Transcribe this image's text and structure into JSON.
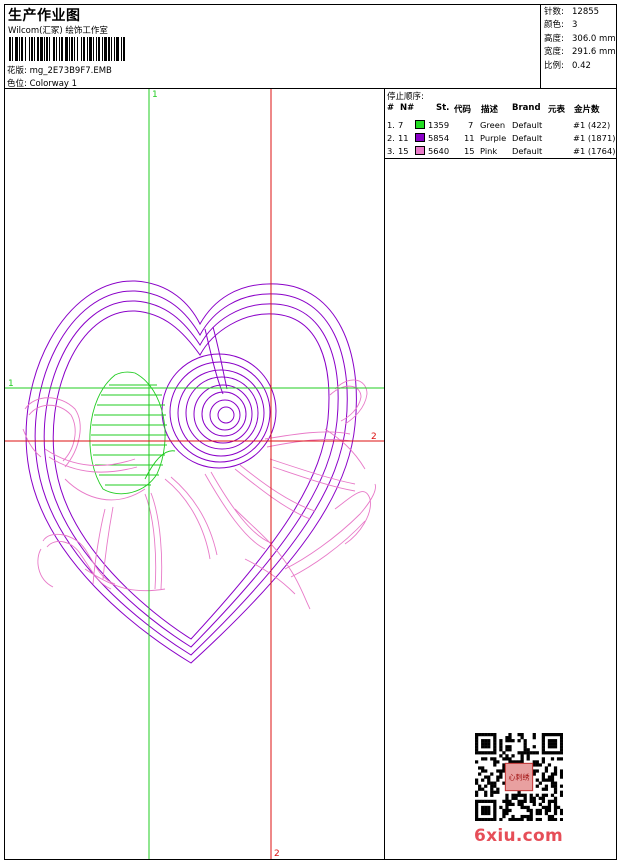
{
  "header": {
    "title": "生产作业图",
    "company": "Wilcom(汇冢) 绘饰工作室",
    "design_label": "花版:",
    "design_value": "mg_2E73B9F7.EMB",
    "colorway_label": "色位:",
    "colorway_value": "Colorway 1"
  },
  "stats": [
    {
      "label": "针数:",
      "value": "12855"
    },
    {
      "label": "颜色:",
      "value": "3"
    },
    {
      "label": "高度:",
      "value": "306.0 mm"
    },
    {
      "label": "宽度:",
      "value": "291.6 mm"
    },
    {
      "label": "比例:",
      "value": "0.42"
    }
  ],
  "stop_sequence": {
    "title": "停止顺序:",
    "columns": [
      "#",
      "N#",
      "St.",
      "代码",
      "描述",
      "Brand",
      "元表",
      "金片数"
    ],
    "rows": [
      {
        "order": "1.",
        "needle": "7",
        "color": "#22dd22",
        "stitches": "1359",
        "code": "7",
        "description": "Green",
        "brand": "Default",
        "chart": "#1 (422)"
      },
      {
        "order": "2.",
        "needle": "11",
        "color": "#8a00c8",
        "stitches": "5854",
        "code": "11",
        "description": "Purple",
        "brand": "Default",
        "chart": "#1 (1871)"
      },
      {
        "order": "3.",
        "needle": "15",
        "color": "#e87ac8",
        "stitches": "5640",
        "code": "15",
        "description": "Pink",
        "brand": "Default",
        "chart": "#1 (1764)"
      }
    ]
  },
  "canvas": {
    "guide_labels": {
      "green_top": "1",
      "green_left": "1",
      "red_right": "2",
      "red_bottom": "2"
    },
    "colors": {
      "green_guide": "#22cc22",
      "red_guide": "#dd1111",
      "purple": "#8a00c8",
      "pink": "#e87ac8",
      "leaf": "#22cc22"
    }
  },
  "watermark": "6xiu.com",
  "qr_stamp": "心刺绣"
}
